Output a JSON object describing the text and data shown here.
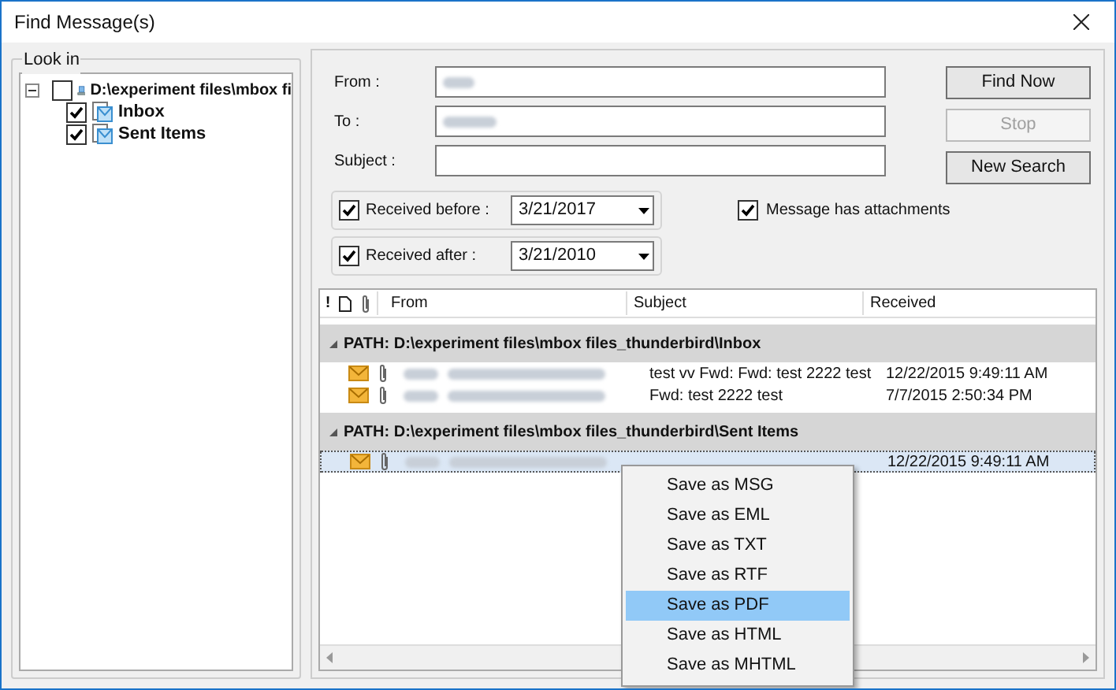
{
  "window": {
    "title": "Find Message(s)"
  },
  "look_in": {
    "label": "Look in",
    "tree": [
      {
        "label": "D:\\experiment files\\mbox fi",
        "checked": false,
        "expanded": true,
        "children": [
          {
            "label": "Inbox",
            "checked": true
          },
          {
            "label": "Sent Items",
            "checked": true
          }
        ]
      }
    ]
  },
  "fields": [
    {
      "label": "From :",
      "redacted": true
    },
    {
      "label": "To :",
      "redacted": true
    },
    {
      "label": "Subject :",
      "redacted": false
    }
  ],
  "buttons": [
    {
      "label": "Find Now",
      "disabled": false
    },
    {
      "label": "Stop",
      "disabled": true
    },
    {
      "label": "New Search",
      "disabled": false
    }
  ],
  "date_filters": [
    {
      "label": "Received before :",
      "checked": true,
      "value": "3/21/2017"
    },
    {
      "label": "Received after :",
      "checked": true,
      "value": "3/21/2010"
    }
  ],
  "attachments_option": {
    "label": "Message has attachments",
    "checked": true
  },
  "table": {
    "columns": [
      "!",
      "From",
      "Subject",
      "Received"
    ],
    "groups": [
      {
        "path": "PATH: D:\\experiment files\\mbox files_thunderbird\\Inbox",
        "rows": [
          {
            "subject": "test vv Fwd: Fwd: test 2222 test",
            "received": "12/22/2015 9:49:11 AM",
            "selected": false
          },
          {
            "subject": "Fwd: test 2222 test",
            "received": "7/7/2015 2:50:34 PM",
            "selected": false
          }
        ]
      },
      {
        "path": "PATH: D:\\experiment files\\mbox files_thunderbird\\Sent Items",
        "rows": [
          {
            "subject": "",
            "received": "12/22/2015 9:49:11 AM",
            "selected": true
          }
        ]
      }
    ]
  },
  "context_menu": [
    {
      "label": "Save as MSG",
      "selected": false
    },
    {
      "label": "Save as EML",
      "selected": false
    },
    {
      "label": "Save as TXT",
      "selected": false
    },
    {
      "label": "Save as RTF",
      "selected": false
    },
    {
      "label": "Save as PDF",
      "selected": true
    },
    {
      "label": "Save as HTML",
      "selected": false
    },
    {
      "label": "Save as MHTML",
      "selected": false
    }
  ]
}
